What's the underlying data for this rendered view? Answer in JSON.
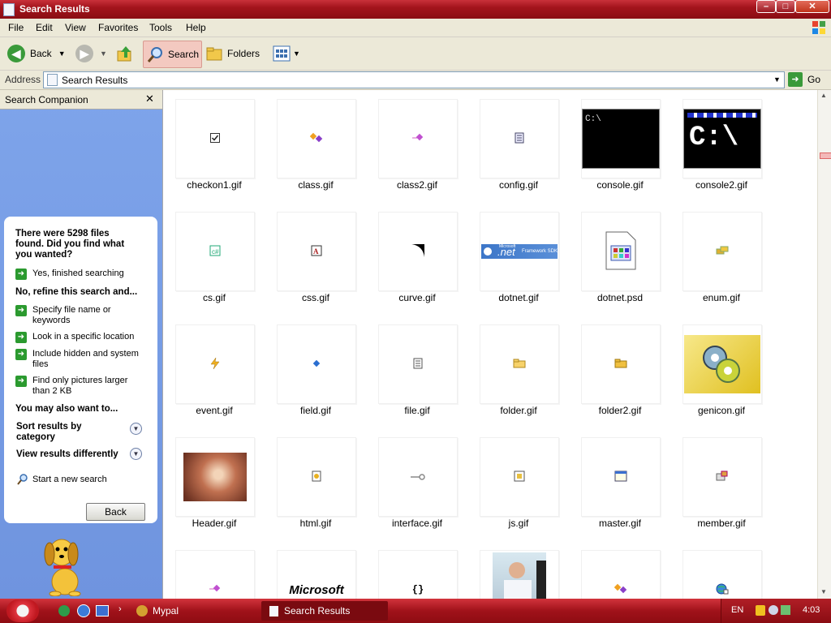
{
  "window": {
    "title": "Search Results",
    "controls": {
      "minimize": "–",
      "maximize": "□",
      "close": "✕"
    }
  },
  "menu": [
    "File",
    "Edit",
    "View",
    "Favorites",
    "Tools",
    "Help"
  ],
  "toolbar": {
    "back": "Back",
    "search": "Search",
    "folders": "Folders"
  },
  "address": {
    "label": "Address",
    "value": "Search Results",
    "go": "Go"
  },
  "companion": {
    "title": "Search Companion",
    "close": "✕",
    "found_message": "There were 5298 files found. Did you find what you wanted?",
    "yes_option": "Yes, finished searching",
    "refine_heading": "No, refine this search and...",
    "refine_options": [
      "Specify file name or keywords",
      "Look in a specific location",
      "Include hidden and system files",
      "Find only pictures larger than 2 KB"
    ],
    "also_heading": "You may also want to...",
    "sort_label": "Sort results by category",
    "view_label": "View results differently",
    "new_search": "Start a new search",
    "back_button": "Back"
  },
  "files": [
    {
      "name": "checkon1.gif",
      "icon": "checkbox-icon"
    },
    {
      "name": "class.gif",
      "icon": "class-icon"
    },
    {
      "name": "class2.gif",
      "icon": "class2-icon"
    },
    {
      "name": "config.gif",
      "icon": "config-icon"
    },
    {
      "name": "console.gif",
      "icon": "console-icon",
      "text": "C:\\"
    },
    {
      "name": "console2.gif",
      "icon": "console2-icon",
      "text": "C:\\"
    },
    {
      "name": "cs.gif",
      "icon": "cs-icon"
    },
    {
      "name": "css.gif",
      "icon": "css-icon"
    },
    {
      "name": "curve.gif",
      "icon": "curve-icon"
    },
    {
      "name": "dotnet.gif",
      "icon": "dotnet-banner-icon",
      "text": ".net",
      "subtext": "Microsoft",
      "tail": "Framework SDK"
    },
    {
      "name": "dotnet.psd",
      "icon": "psd-document-icon"
    },
    {
      "name": "enum.gif",
      "icon": "enum-icon"
    },
    {
      "name": "event.gif",
      "icon": "lightning-icon"
    },
    {
      "name": "field.gif",
      "icon": "field-icon"
    },
    {
      "name": "file.gif",
      "icon": "file-icon"
    },
    {
      "name": "folder.gif",
      "icon": "folder-icon"
    },
    {
      "name": "folder2.gif",
      "icon": "folder2-icon"
    },
    {
      "name": "genicon.gif",
      "icon": "gears-icon"
    },
    {
      "name": "Header.gif",
      "icon": "header-image"
    },
    {
      "name": "html.gif",
      "icon": "html-icon"
    },
    {
      "name": "interface.gif",
      "icon": "interface-icon"
    },
    {
      "name": "js.gif",
      "icon": "js-icon"
    },
    {
      "name": "master.gif",
      "icon": "window-icon"
    },
    {
      "name": "member.gif",
      "icon": "member-icon"
    },
    {
      "name": "",
      "icon": "class2-icon"
    },
    {
      "name": "",
      "icon": "microsoft-logo",
      "text": "Microsoft"
    },
    {
      "name": "",
      "icon": "braces-icon",
      "text": "{}"
    },
    {
      "name": "",
      "icon": "person-photo"
    },
    {
      "name": "",
      "icon": "class-icon"
    },
    {
      "name": "",
      "icon": "globe-icon"
    }
  ],
  "taskbar": {
    "mypal": "Mypal",
    "active_window": "Search Results",
    "lang": "EN",
    "clock": "4:03"
  }
}
